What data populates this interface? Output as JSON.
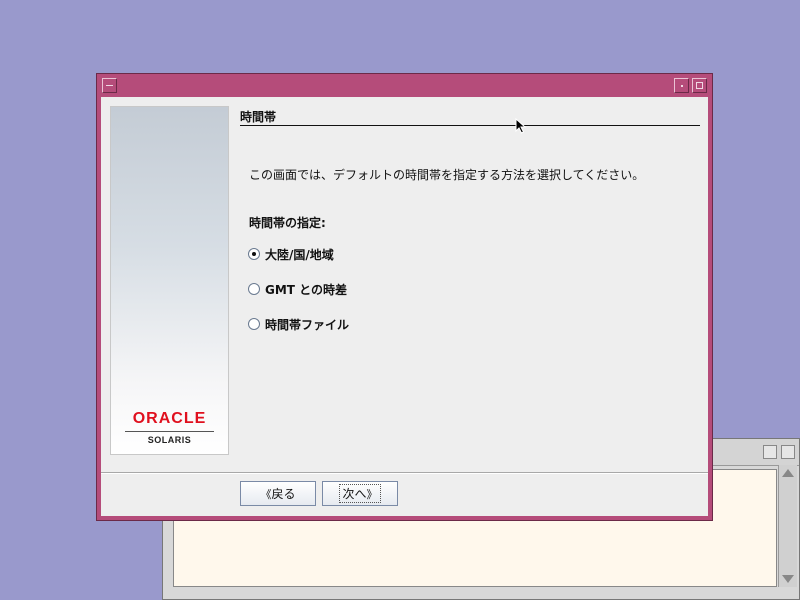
{
  "dialog": {
    "section_title": "時間帯",
    "description": "この画面では、デフォルトの時間帯を指定する方法を選択してください。",
    "group_label": "時間帯の指定:",
    "options": [
      {
        "label": "大陸/国/地域",
        "selected": true
      },
      {
        "label": "GMT との時差",
        "selected": false
      },
      {
        "label": "時間帯ファイル",
        "selected": false
      }
    ],
    "buttons": {
      "back_label": "戻る",
      "next_label": "次へ",
      "back_chevron": "《",
      "next_chevron": "》"
    }
  },
  "branding": {
    "oracle": "ORACLE",
    "solaris": "SOLARIS"
  },
  "colors": {
    "desktop": "#9999cc",
    "titlebar": "#b54c7a",
    "oracle_red": "#e0101e"
  }
}
